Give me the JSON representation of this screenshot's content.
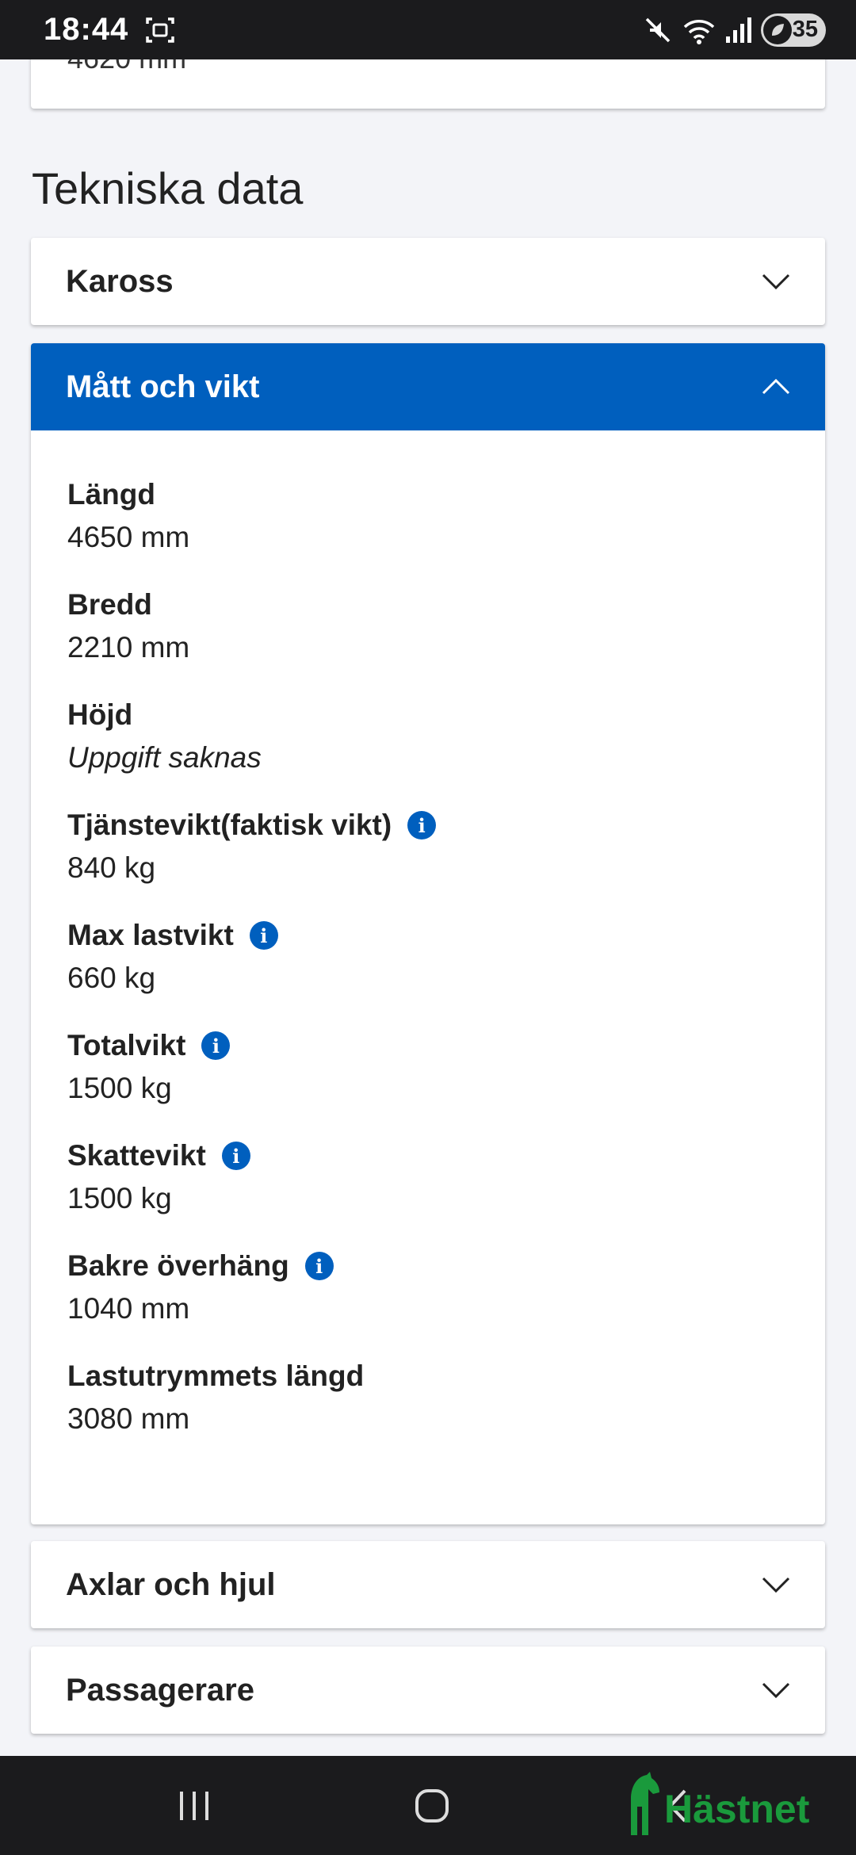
{
  "status_bar": {
    "time": "18:44",
    "battery": "35"
  },
  "prev_card": {
    "cut_text": "4620 mm"
  },
  "section_title": "Tekniska data",
  "accordions": {
    "kaross": {
      "label": "Kaross"
    },
    "matt": {
      "label": "Mått och vikt"
    },
    "axlar": {
      "label": "Axlar och hjul"
    },
    "passagerare": {
      "label": "Passagerare"
    }
  },
  "fields": [
    {
      "label": "Längd",
      "value": "4650 mm"
    },
    {
      "label": "Bredd",
      "value": "2210 mm"
    },
    {
      "label": "Höjd",
      "value": "Uppgift saknas"
    },
    {
      "label": "Tjänstevikt(faktisk vikt)",
      "value": "840 kg"
    },
    {
      "label": "Max lastvikt",
      "value": "660 kg"
    },
    {
      "label": "Totalvikt",
      "value": "1500 kg"
    },
    {
      "label": "Skattevikt",
      "value": "1500 kg"
    },
    {
      "label": "Bakre överhäng",
      "value": "1040 mm"
    },
    {
      "label": "Lastutrymmets längd",
      "value": "3080 mm"
    }
  ],
  "info_glyph": "i",
  "logo": {
    "text": "Hästnet"
  },
  "colors": {
    "accent": "#005fbe",
    "logo": "#1a9a3c"
  }
}
